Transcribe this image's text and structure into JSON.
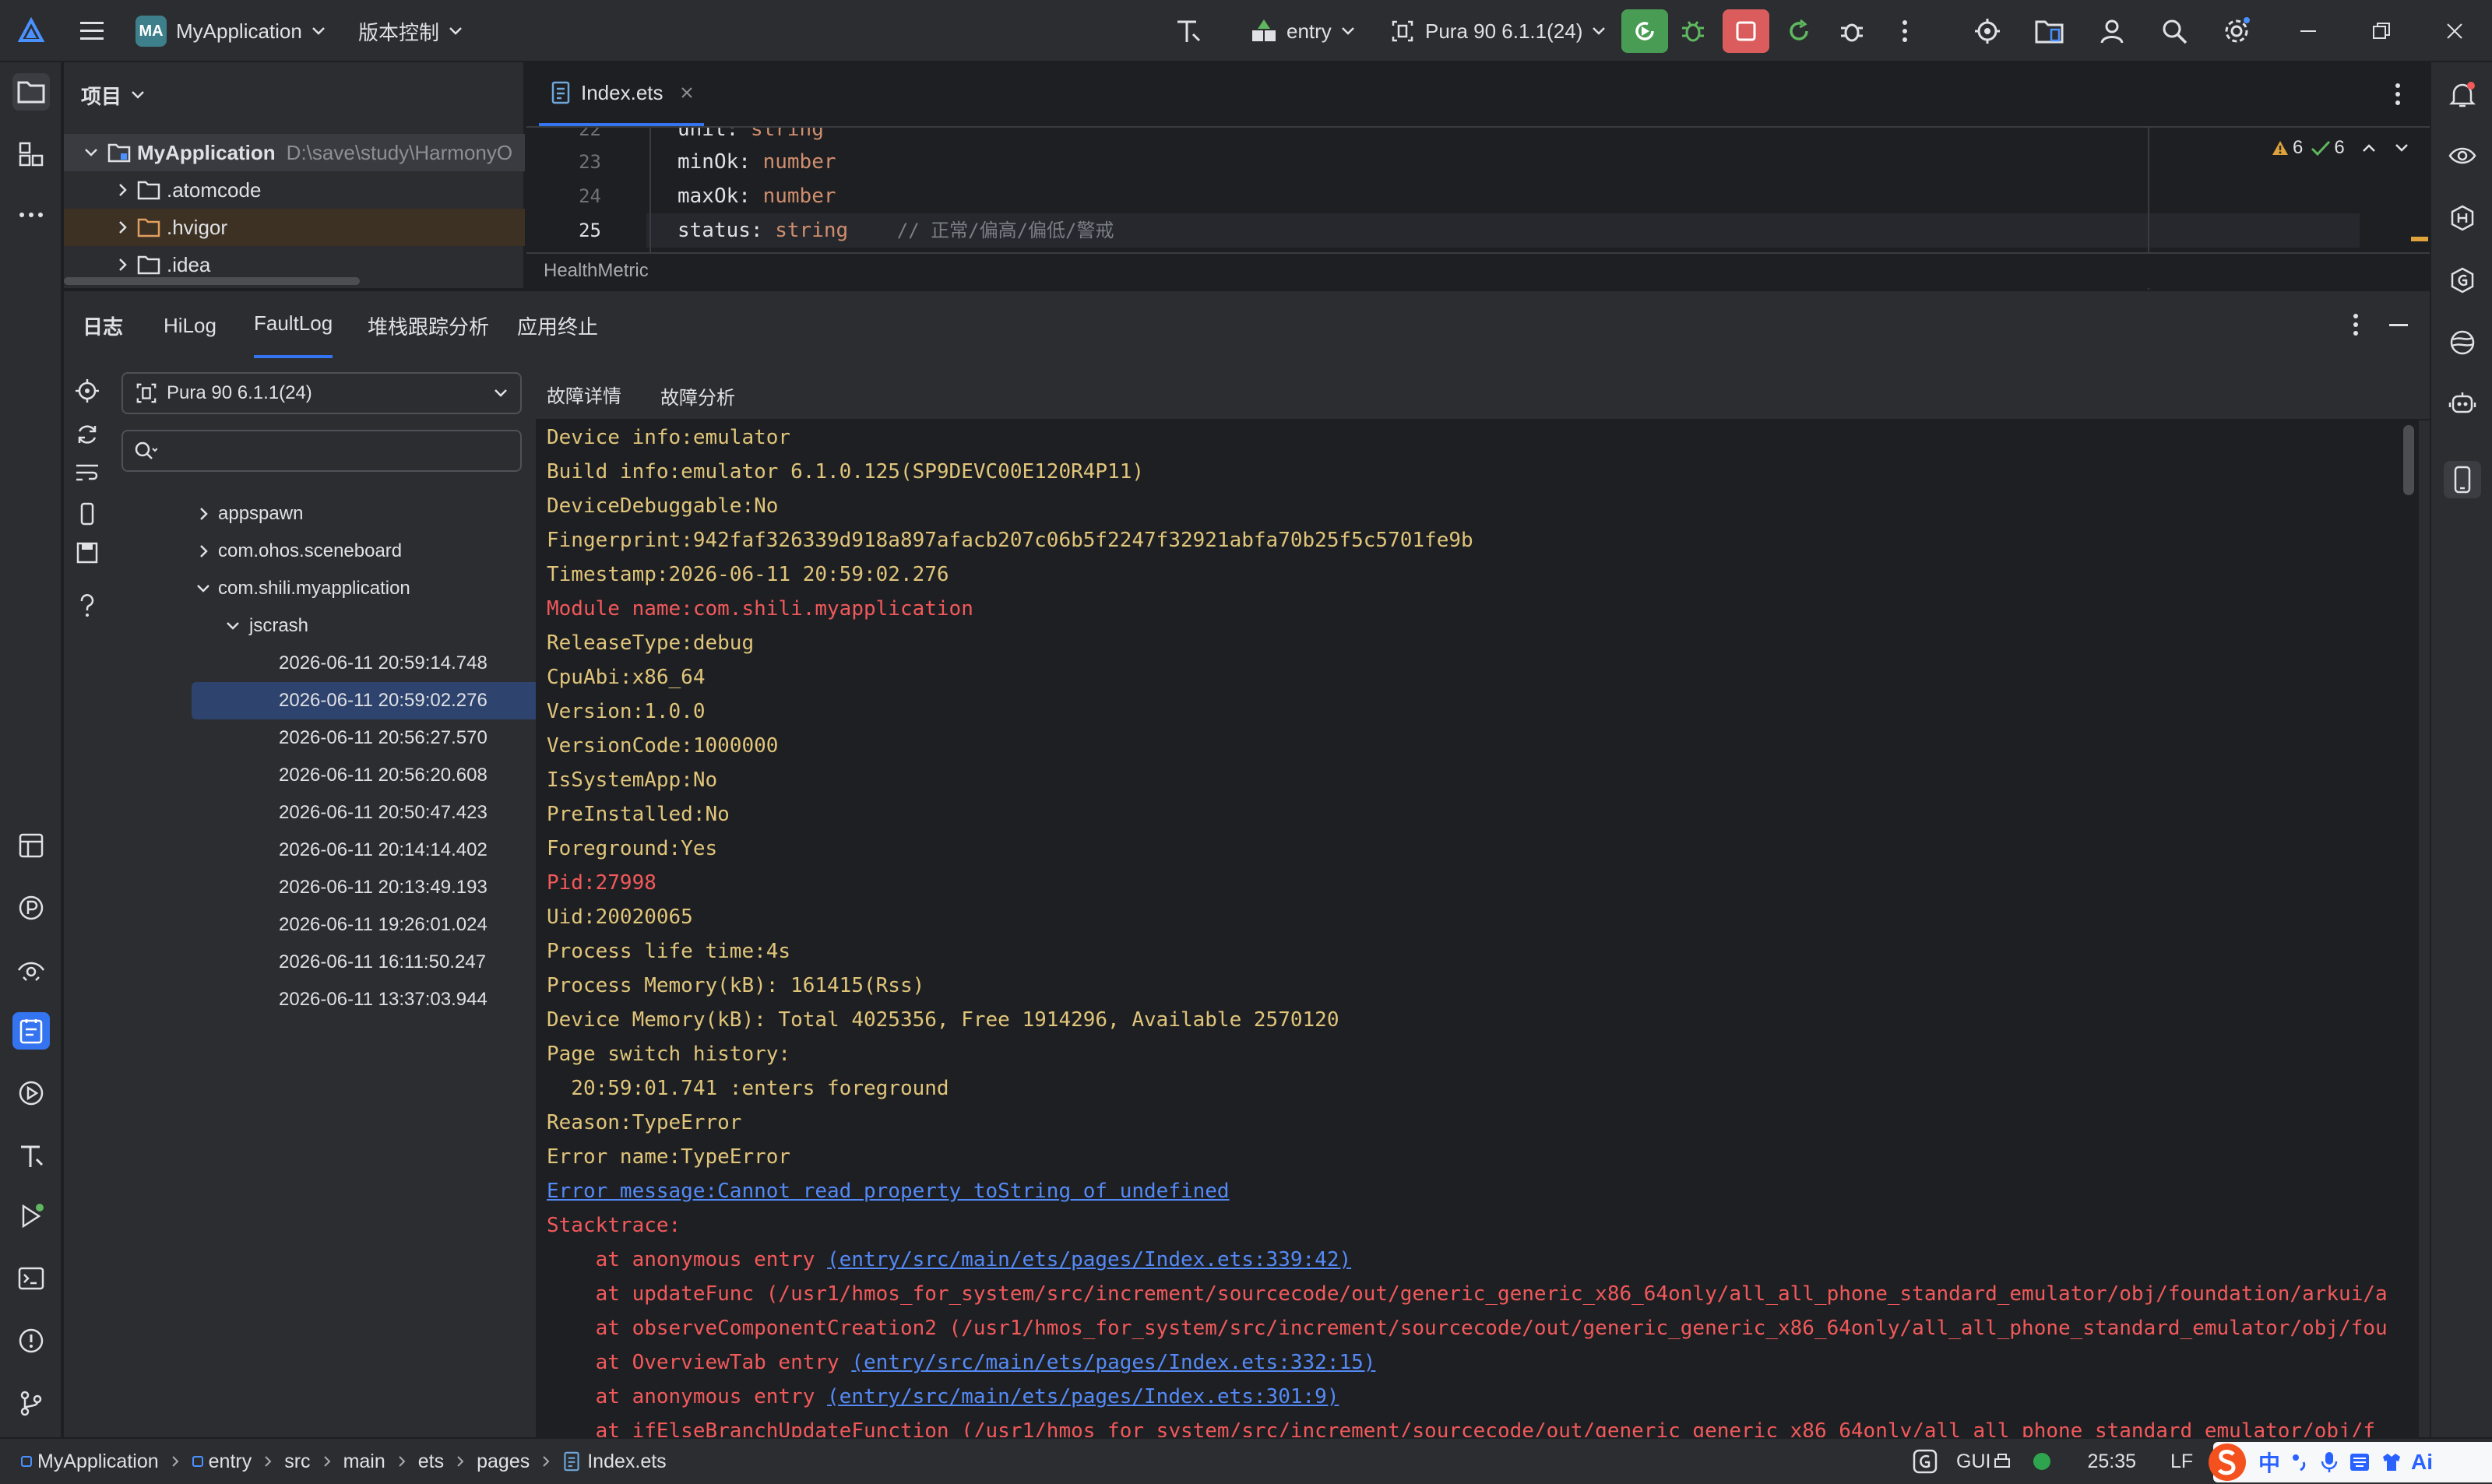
{
  "titlebar": {
    "project_badge": "MA",
    "project_name": "MyApplication",
    "vcs_label": "版本控制",
    "module": "entry",
    "device": "Pura 90 6.1.1(24)"
  },
  "project_panel": {
    "title": "项目",
    "root": {
      "name": "MyApplication",
      "path": "D:\\save\\study\\HarmonyO"
    },
    "items": [
      ".atomcode",
      ".hvigor",
      ".idea"
    ]
  },
  "editor": {
    "tab": "Index.ets",
    "lines": [
      {
        "num": "22",
        "name": "unit",
        "type": "string",
        "comment": ""
      },
      {
        "num": "23",
        "name": "minOk",
        "type": "number",
        "comment": ""
      },
      {
        "num": "24",
        "name": "maxOk",
        "type": "number",
        "comment": ""
      },
      {
        "num": "25",
        "name": "status",
        "type": "string",
        "comment": "// 正常/偏高/偏低/警戒"
      }
    ],
    "warnings": "6",
    "checks": "6",
    "breadcrumb": "HealthMetric"
  },
  "toolwindow": {
    "title": "日志",
    "tabs": [
      "HiLog",
      "FaultLog",
      "堆栈跟踪分析",
      "应用终止"
    ],
    "active_tab": "FaultLog",
    "device_select": "Pura 90 6.1.1(24)",
    "search_placeholder": "",
    "tree": {
      "apps": [
        "appspawn",
        "com.ohos.sceneboard",
        "com.shili.myapplication"
      ],
      "subfolder": "jscrash",
      "entries": [
        "2026-06-11 20:59:14.748",
        "2026-06-11 20:59:02.276",
        "2026-06-11 20:56:27.570",
        "2026-06-11 20:56:20.608",
        "2026-06-11 20:50:47.423",
        "2026-06-11 20:14:14.402",
        "2026-06-11 20:13:49.193",
        "2026-06-11 19:26:01.024",
        "2026-06-11 16:11:50.247",
        "2026-06-11 13:37:03.944"
      ],
      "selected_index": 1
    },
    "detail_tabs": [
      "故障详情",
      "故障分析"
    ],
    "log_lines": [
      {
        "style": "y",
        "text": "Device info:emulator"
      },
      {
        "style": "y",
        "text": "Build info:emulator 6.1.0.125(SP9DEVC00E120R4P11)"
      },
      {
        "style": "y",
        "text": "DeviceDebuggable:No"
      },
      {
        "style": "y",
        "text": "Fingerprint:942faf326339d918a897afacb207c06b5f2247f32921abfa70b25f5c5701fe9b"
      },
      {
        "style": "y",
        "text": "Timestamp:2026-06-11 20:59:02.276"
      },
      {
        "style": "r",
        "text": "Module name:com.shili.myapplication"
      },
      {
        "style": "y",
        "text": "ReleaseType:debug"
      },
      {
        "style": "y",
        "text": "CpuAbi:x86_64"
      },
      {
        "style": "y",
        "text": "Version:1.0.0"
      },
      {
        "style": "y",
        "text": "VersionCode:1000000"
      },
      {
        "style": "y",
        "text": "IsSystemApp:No"
      },
      {
        "style": "y",
        "text": "PreInstalled:No"
      },
      {
        "style": "y",
        "text": "Foreground:Yes"
      },
      {
        "style": "r",
        "text": "Pid:27998"
      },
      {
        "style": "y",
        "text": "Uid:20020065"
      },
      {
        "style": "y",
        "text": "Process life time:4s"
      },
      {
        "style": "y",
        "text": "Process Memory(kB): 161415(Rss)"
      },
      {
        "style": "y",
        "text": "Device Memory(kB): Total 4025356, Free 1914296, Available 2570120"
      },
      {
        "style": "y",
        "text": "Page switch history:"
      },
      {
        "style": "y",
        "text": "  20:59:01.741 :enters foreground"
      },
      {
        "style": "y",
        "text": "Reason:TypeError"
      },
      {
        "style": "y",
        "text": "Error name:TypeError"
      },
      {
        "style": "l",
        "text": "Error message:Cannot read property toString of undefined"
      },
      {
        "style": "r",
        "text": "Stacktrace:"
      }
    ],
    "stack_lines": [
      {
        "prefix": "    at anonymous entry ",
        "link": "(entry/src/main/ets/pages/Index.ets:339:42)",
        "rest": ""
      },
      {
        "prefix": "    at updateFunc (/usr1/hmos_for_system/src/increment/sourcecode/out/generic_generic_x86_64only/all_all_phone_standard_emulator/obj/foundation/arkui/a",
        "link": "",
        "rest": ""
      },
      {
        "prefix": "    at observeComponentCreation2 (/usr1/hmos_for_system/src/increment/sourcecode/out/generic_generic_x86_64only/all_all_phone_standard_emulator/obj/fou",
        "link": "",
        "rest": ""
      },
      {
        "prefix": "    at OverviewTab entry ",
        "link": "(entry/src/main/ets/pages/Index.ets:332:15)",
        "rest": ""
      },
      {
        "prefix": "    at anonymous entry ",
        "link": "(entry/src/main/ets/pages/Index.ets:301:9)",
        "rest": ""
      },
      {
        "prefix": "    at ifElseBranchUpdateFunction (/usr1/hmos_for_system/src/increment/sourcecode/out/generic_generic_x86_64only/all_all_phone_standard_emulator/obj/f",
        "link": "",
        "rest": ""
      }
    ]
  },
  "statusbar": {
    "crumbs": [
      "MyApplication",
      "entry",
      "src",
      "main",
      "ets",
      "pages",
      "Index.ets"
    ],
    "gui": "GUI",
    "position": "25:35",
    "line_sep": "LF",
    "encoding": "U",
    "ime": "中"
  },
  "colors": {
    "accent": "#3574f0",
    "run_green": "#499c54",
    "stop_red": "#db5c5c",
    "log_yellow": "#e0c57a",
    "log_red": "#f2595b",
    "link_blue": "#548af7"
  }
}
